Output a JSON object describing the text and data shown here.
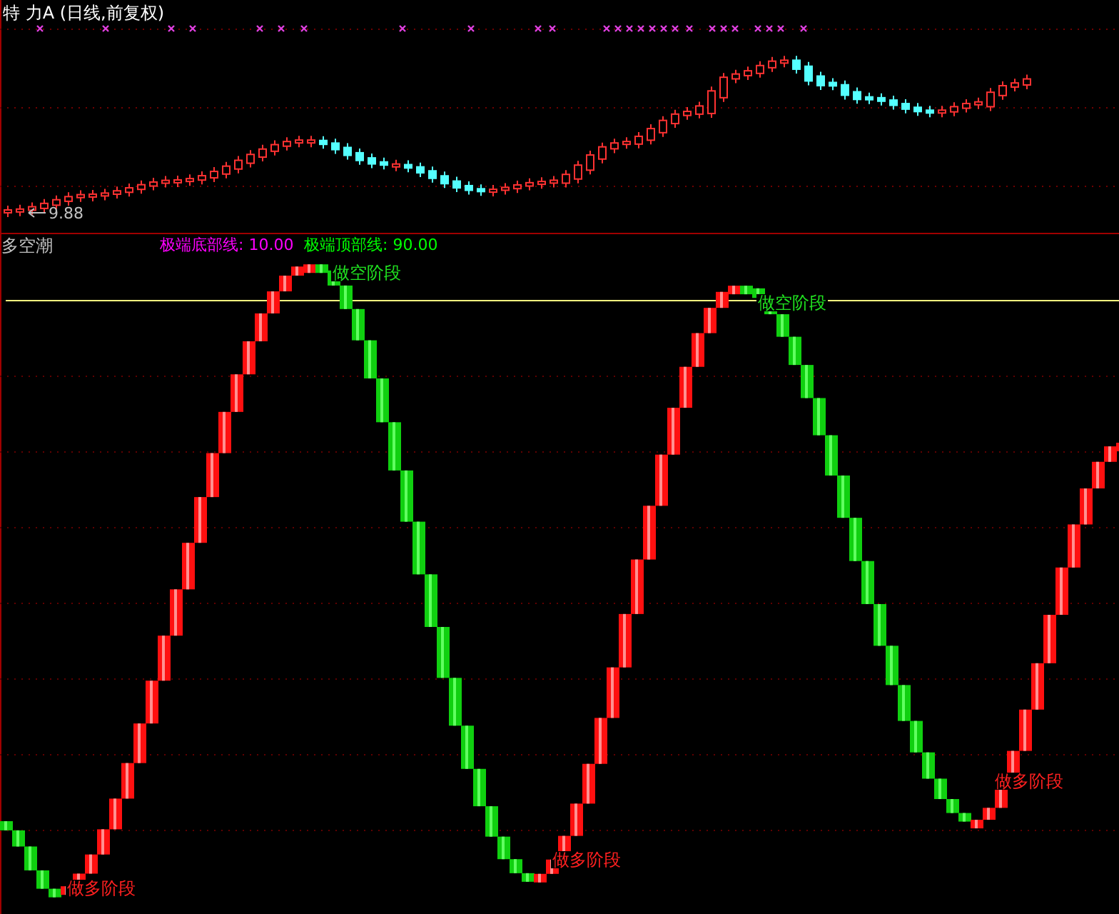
{
  "price_panel": {
    "title": "特 力A (日线,前复权)",
    "low_marker": "9.88"
  },
  "indicator_panel": {
    "title": "多空潮",
    "lines": [
      {
        "label": "极端底部线: 10.00",
        "color": "#ff00ff"
      },
      {
        "label": "极端顶部线: 90.00",
        "color": "#00ff00"
      }
    ],
    "annotations": [
      {
        "text": "做空阶段",
        "kind": "sell"
      },
      {
        "text": "做空阶段",
        "kind": "sell"
      },
      {
        "text": "做多阶段",
        "kind": "buy"
      },
      {
        "text": "做多阶段",
        "kind": "buy"
      },
      {
        "text": "做多阶段",
        "kind": "buy"
      }
    ]
  }
}
